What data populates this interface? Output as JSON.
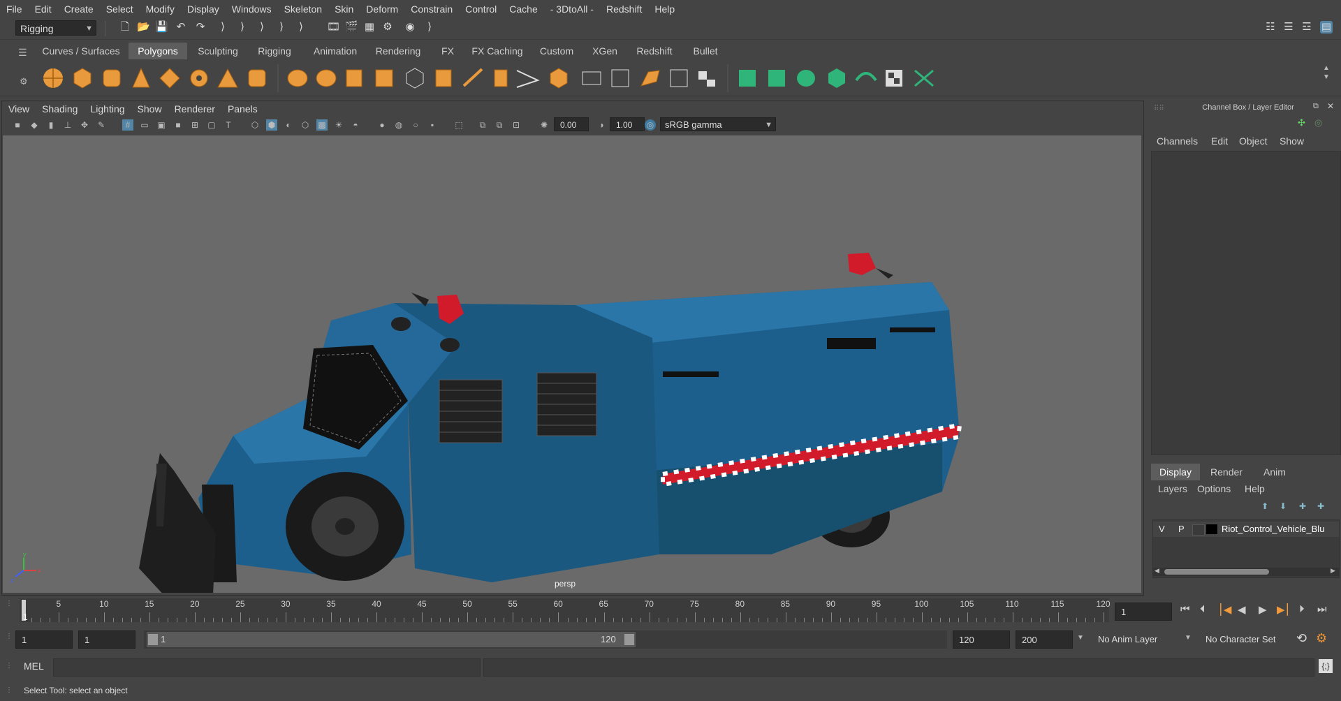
{
  "menu": [
    "File",
    "Edit",
    "Create",
    "Select",
    "Modify",
    "Display",
    "Windows",
    "Skeleton",
    "Skin",
    "Deform",
    "Constrain",
    "Control",
    "Cache",
    "- 3DtoAll -",
    "Redshift",
    "Help"
  ],
  "statusline": {
    "menuset": "Rigging"
  },
  "shelf_tabs": [
    "Curves / Surfaces",
    "Polygons",
    "Sculpting",
    "Rigging",
    "Animation",
    "Rendering",
    "FX",
    "FX Caching",
    "Custom",
    "XGen",
    "Redshift",
    "Bullet"
  ],
  "shelf_active": "Polygons",
  "viewport_menu": [
    "View",
    "Shading",
    "Lighting",
    "Show",
    "Renderer",
    "Panels"
  ],
  "viewport_toolbar": {
    "exposure": "0.00",
    "gamma": "1.00",
    "colorspace": "sRGB gamma"
  },
  "viewport_camera": "persp",
  "axis_labels": {
    "x": "x",
    "y": "y",
    "z": "z"
  },
  "right_panel": {
    "title": "Channel Box / Layer Editor",
    "channel_menu": [
      "Channels",
      "Edit",
      "Object",
      "Show"
    ],
    "tabs": [
      "Display",
      "Render",
      "Anim"
    ],
    "active_tab": "Display",
    "layer_menu": [
      "Layers",
      "Options",
      "Help"
    ],
    "layer": {
      "visible": "V",
      "playback": "P",
      "name": "Riot_Control_Vehicle_Blu"
    }
  },
  "timeline": {
    "ticks": [
      "5",
      "10",
      "15",
      "20",
      "25",
      "30",
      "35",
      "40",
      "45",
      "50",
      "55",
      "60",
      "65",
      "70",
      "75",
      "80",
      "85",
      "90",
      "95",
      "100",
      "105",
      "110",
      "115",
      "120"
    ],
    "current_marker": "1",
    "current_frame": "1"
  },
  "range": {
    "start": "1",
    "playback_start": "1",
    "slider_start": "1",
    "slider_end": "120",
    "playback_end": "120",
    "end": "200",
    "anim_layer": "No Anim Layer",
    "character_set": "No Character Set"
  },
  "command": {
    "lang": "MEL"
  },
  "help_line": "Select Tool: select an object",
  "colors": {
    "vehicle_body": "#1d5f8c",
    "accent_red": "#d11a2a",
    "viewport_bg": "#6a6a6a"
  }
}
